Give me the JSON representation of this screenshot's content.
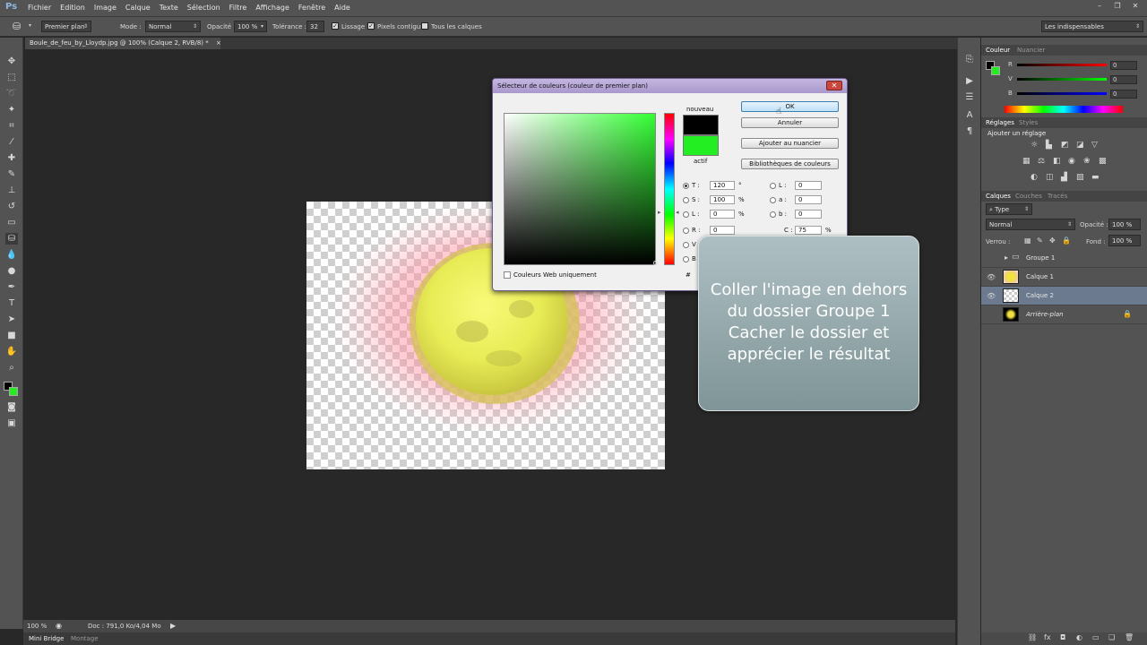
{
  "app": {
    "logo": "Ps",
    "workspace": "Les indispensables"
  },
  "menu": [
    "Fichier",
    "Edition",
    "Image",
    "Calque",
    "Texte",
    "Sélection",
    "Filtre",
    "Affichage",
    "Fenêtre",
    "Aide"
  ],
  "options": {
    "fill_source": "Premier plan",
    "mode_label": "Mode :",
    "mode_value": "Normal",
    "opacity_label": "Opacité :",
    "opacity_value": "100 %",
    "tolerance_label": "Tolérance :",
    "tolerance_value": "32",
    "antialias_label": "Lissage",
    "contiguous_label": "Pixels contigus",
    "all_layers_label": "Tous les calques"
  },
  "document": {
    "tab_title": "Boule_de_feu_by_Lloydp.jpg @ 100% (Calque 2, RVB/8) *",
    "tab_close": "×"
  },
  "status": {
    "zoom": "100 %",
    "doc": "Doc : 791,0 Ko/4,04 Mo"
  },
  "bottom_tabs": [
    "Mini Bridge",
    "Montage"
  ],
  "dialog": {
    "title": "Sélecteur de couleurs (couleur de premier plan)",
    "new_label": "nouveau",
    "current_label": "actif",
    "new_color": "#000000",
    "current_color": "#22ee22",
    "ok": "OK",
    "cancel": "Annuler",
    "add_swatch": "Ajouter au nuancier",
    "libraries": "Bibliothèques de couleurs",
    "web_only": "Couleurs Web uniquement",
    "fields": {
      "T": {
        "label": "T :",
        "value": "120",
        "unit": "°"
      },
      "S": {
        "label": "S :",
        "value": "100",
        "unit": "%"
      },
      "Lb": {
        "label": "L :",
        "value": "0",
        "unit": "%"
      },
      "R": {
        "label": "R :",
        "value": "0"
      },
      "V": {
        "label": "V :"
      },
      "B": {
        "label": "B :"
      },
      "L": {
        "label": "L :",
        "value": "0"
      },
      "a": {
        "label": "a :",
        "value": "0"
      },
      "b": {
        "label": "b :",
        "value": "0"
      },
      "C": {
        "label": "C :",
        "value": "75",
        "unit": "%"
      },
      "hex": {
        "label": "#"
      }
    }
  },
  "callout": {
    "lines": [
      "Coller l'image en dehors",
      "du dossier Groupe 1",
      "Cacher le dossier et",
      "apprécier le résultat"
    ]
  },
  "color_panel": {
    "tabs": [
      "Couleur",
      "Nuancier"
    ],
    "R": {
      "label": "R",
      "value": "0"
    },
    "V": {
      "label": "V",
      "value": "0"
    },
    "B": {
      "label": "B",
      "value": "0"
    }
  },
  "adjust_panel": {
    "tabs": [
      "Réglages",
      "Styles"
    ],
    "title": "Ajouter un réglage"
  },
  "layers_panel": {
    "tabs": [
      "Calques",
      "Couches",
      "Tracés"
    ],
    "filter": "Type",
    "blend": "Normal",
    "opacity_label": "Opacité :",
    "opacity_value": "100 %",
    "lock_label": "Verrou :",
    "fill_label": "Fond :",
    "fill_value": "100 %",
    "layers": [
      {
        "name": "Groupe 1",
        "type": "group",
        "visible": false
      },
      {
        "name": "Calque 1",
        "type": "layer",
        "visible": true
      },
      {
        "name": "Calque 2",
        "type": "layer",
        "visible": true,
        "selected": true
      },
      {
        "name": "Arrière-plan",
        "type": "background",
        "visible": false
      }
    ]
  }
}
